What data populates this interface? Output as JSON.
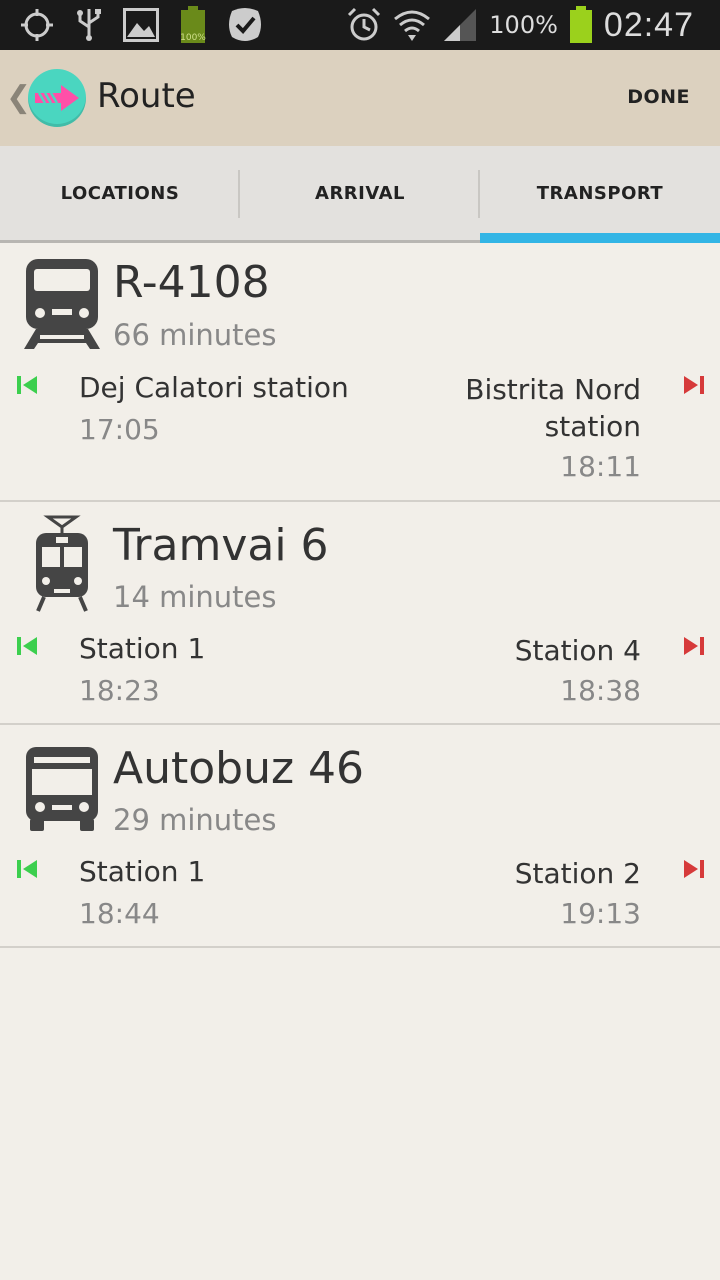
{
  "status_bar": {
    "icons_left": [
      "gps-icon",
      "usb-icon",
      "image-icon",
      "battery-full-icon",
      "check-app-icon"
    ],
    "icons_right": [
      "alarm-icon",
      "wifi-icon",
      "signal-icon"
    ],
    "battery_percent": "100%",
    "time": "02:47"
  },
  "actionbar": {
    "title": "Route",
    "done_label": "DONE"
  },
  "tabs": [
    {
      "label": "LOCATIONS",
      "active": false
    },
    {
      "label": "ARRIVAL",
      "active": false
    },
    {
      "label": "TRANSPORT",
      "active": true
    }
  ],
  "routes": [
    {
      "type": "train",
      "name": "R-4108",
      "duration": "66 minutes",
      "from": "Dej Calatori station",
      "from_time": "17:05",
      "to": "Bistrita Nord station",
      "to_time": "18:11"
    },
    {
      "type": "tram",
      "name": "Tramvai 6",
      "duration": "14 minutes",
      "from": "Station 1",
      "from_time": "18:23",
      "to": "Station 4",
      "to_time": "18:38"
    },
    {
      "type": "bus",
      "name": "Autobuz 46",
      "duration": "29 minutes",
      "from": "Station 1",
      "from_time": "18:44",
      "to": "Station 2",
      "to_time": "19:13"
    }
  ],
  "colors": {
    "start_marker": "#3ccf4e",
    "end_marker": "#d63a3a",
    "tab_indicator": "#33b5e5",
    "actionbar": "#dcd1bf"
  }
}
